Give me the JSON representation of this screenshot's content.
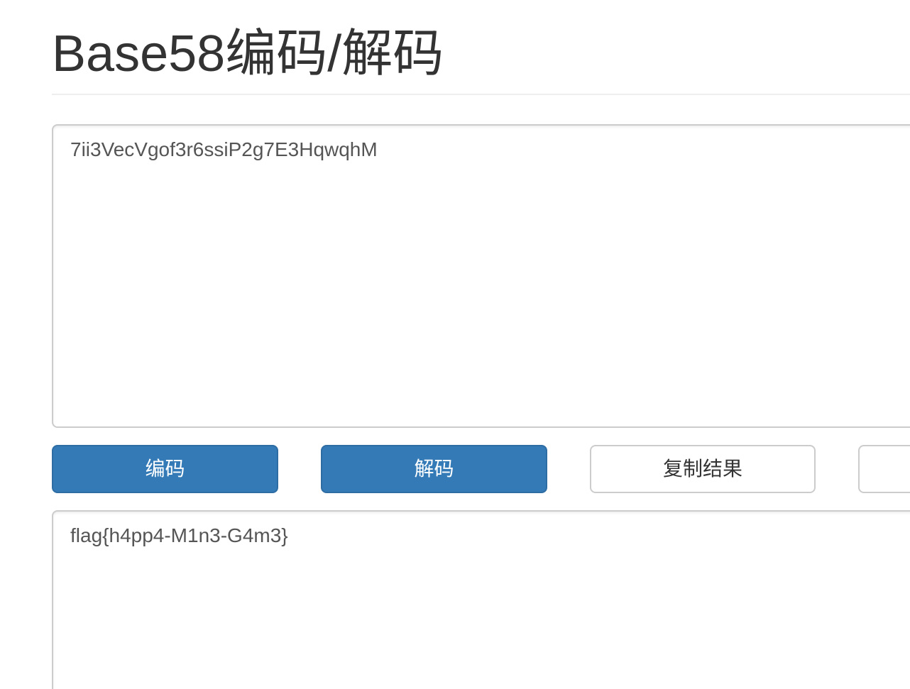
{
  "page": {
    "title": "Base58编码/解码"
  },
  "input": {
    "value": "7ii3VecVgof3r6ssiP2g7E3HqwqhM"
  },
  "buttons": {
    "encode_label": "编码",
    "decode_label": "解码",
    "copy_label": "复制结果",
    "extra_label": ""
  },
  "output": {
    "value": "flag{h4pp4-M1n3-G4m3}"
  },
  "colors": {
    "primary": "#337ab7",
    "primary_border": "#2e6da4",
    "default_border": "#cccccc",
    "text": "#333333"
  }
}
